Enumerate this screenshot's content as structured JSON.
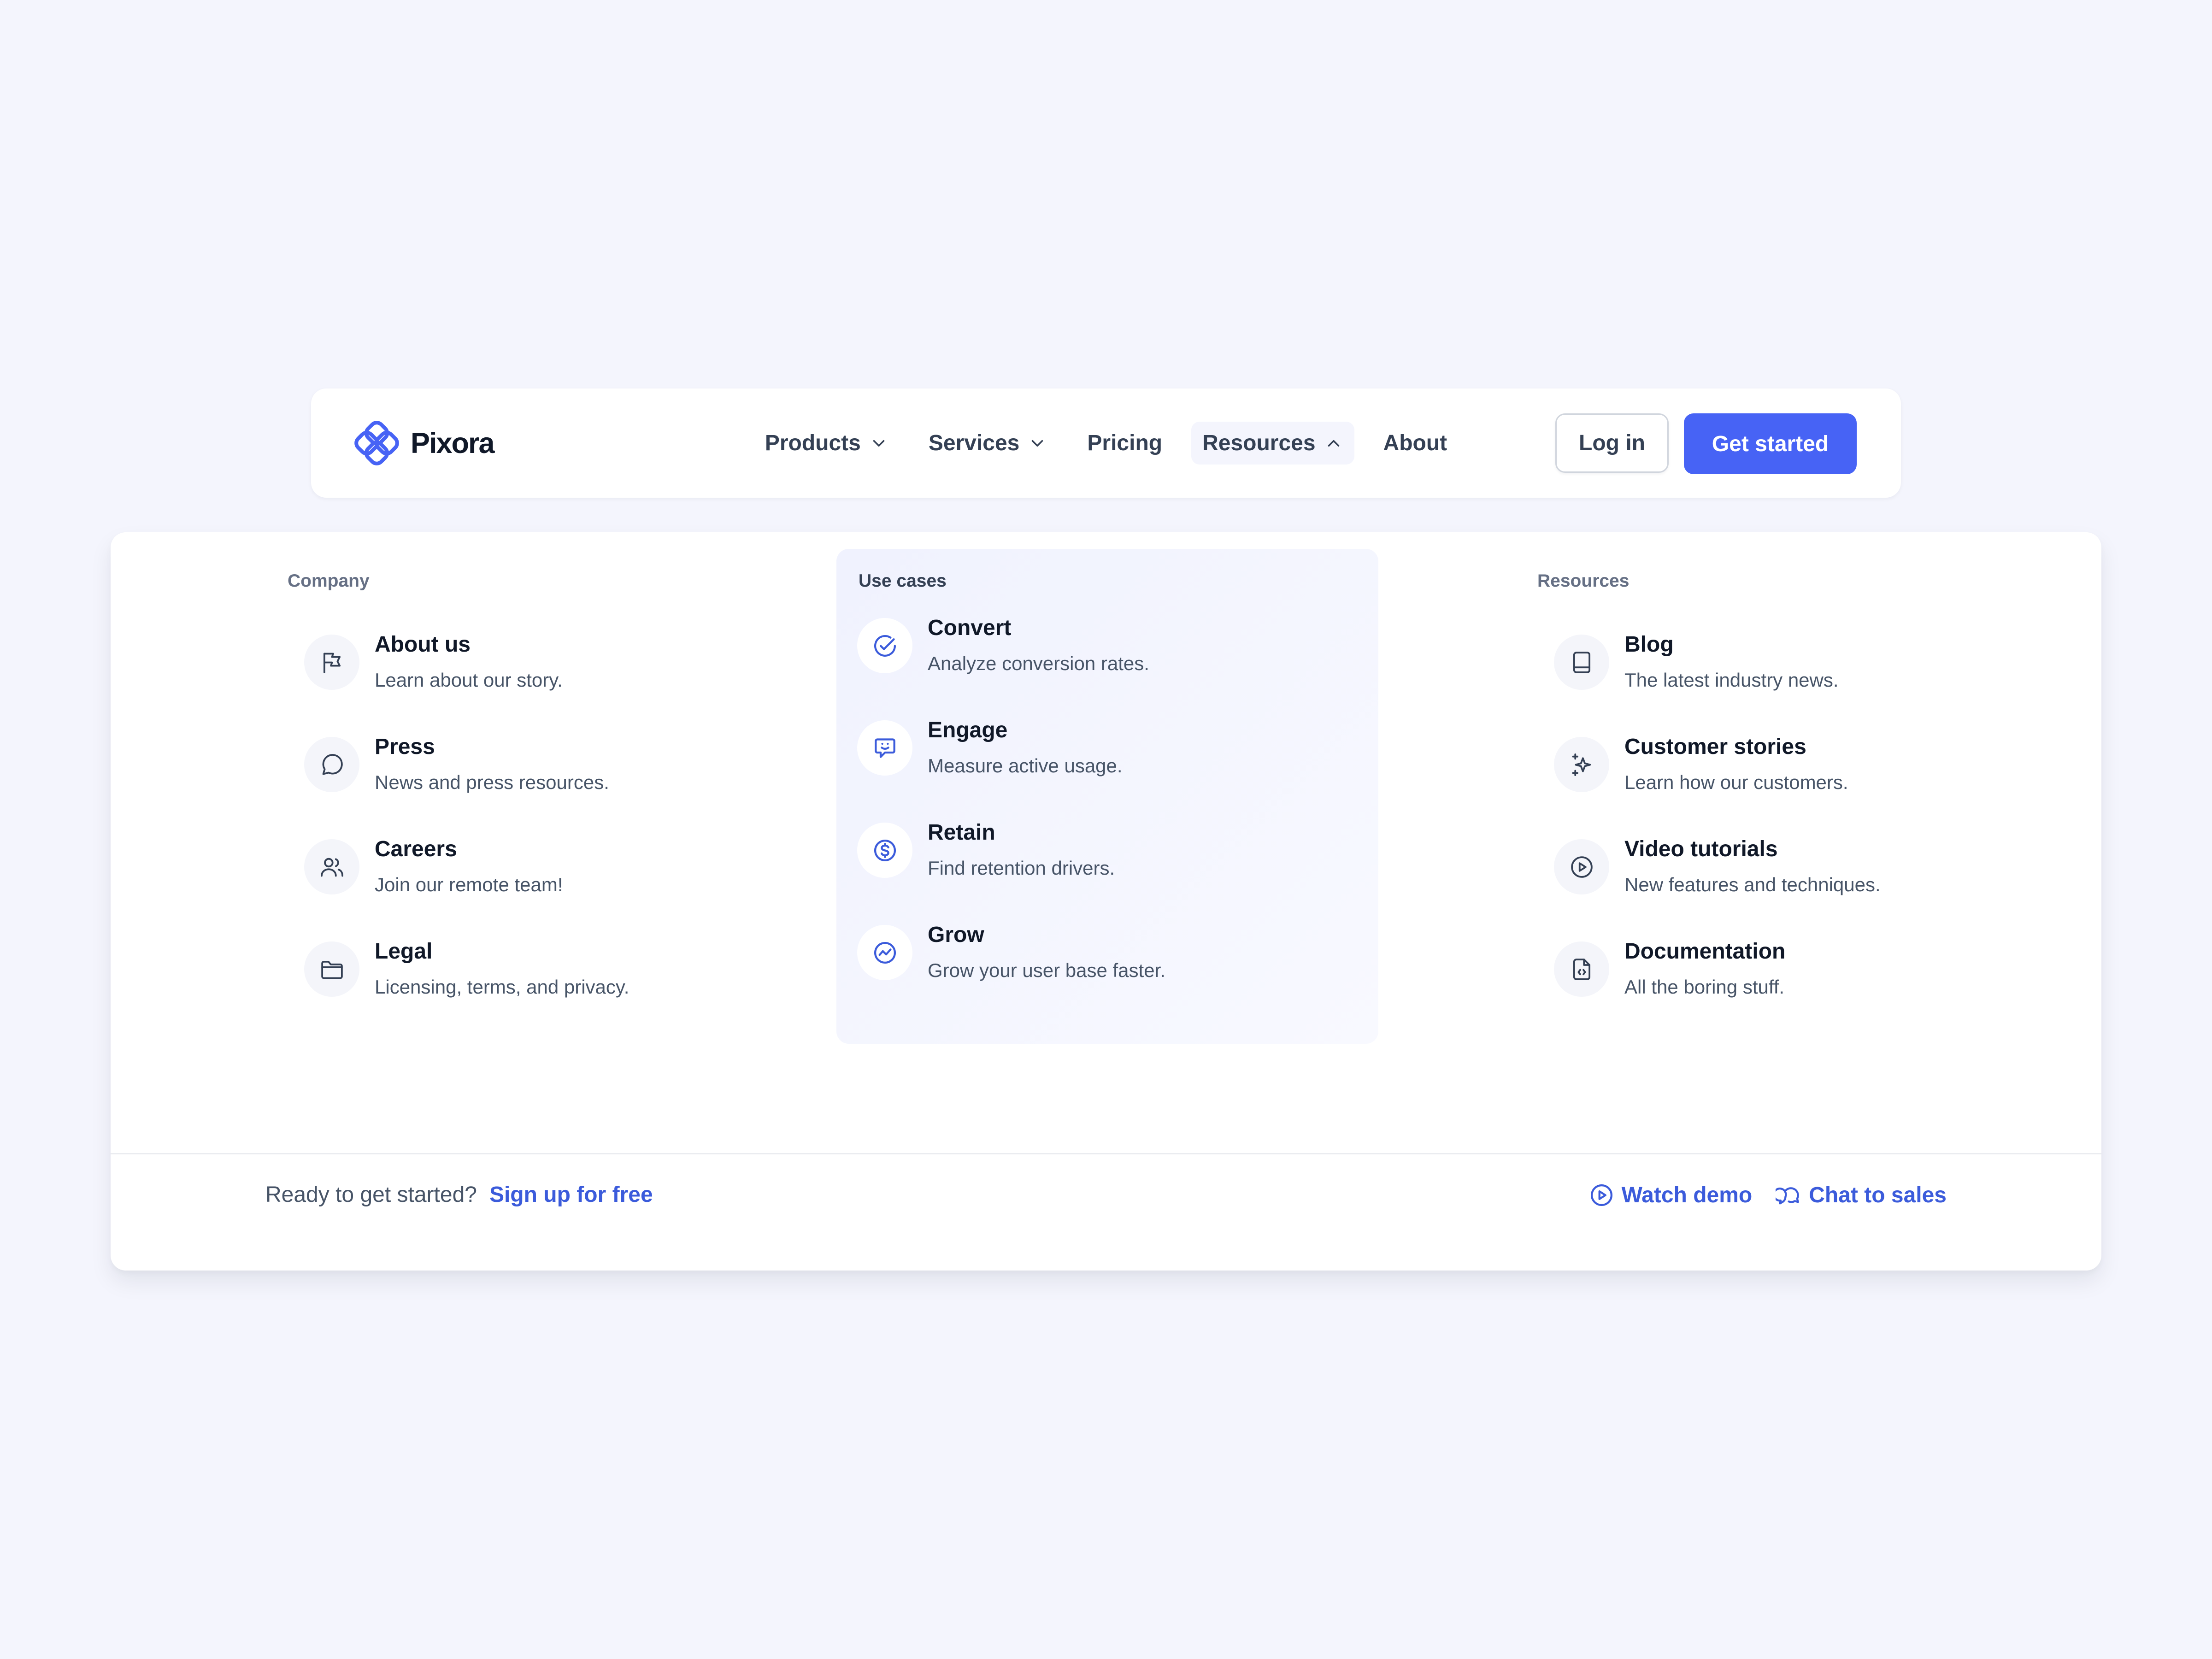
{
  "header": {
    "brand": "Pixora",
    "nav": [
      {
        "label": "Products",
        "has_dropdown": true
      },
      {
        "label": "Services",
        "has_dropdown": true
      },
      {
        "label": "Pricing",
        "has_dropdown": false
      },
      {
        "label": "Resources",
        "has_dropdown": true,
        "active": true
      },
      {
        "label": "About",
        "has_dropdown": false
      }
    ],
    "login_label": "Log in",
    "cta_label": "Get started"
  },
  "menu": {
    "company": {
      "title": "Company",
      "items": [
        {
          "title": "About us",
          "desc": "Learn about our story.",
          "icon": "flag-icon"
        },
        {
          "title": "Press",
          "desc": "News and press resources.",
          "icon": "chat-bubble-icon"
        },
        {
          "title": "Careers",
          "desc": "Join our remote team!",
          "icon": "users-icon"
        },
        {
          "title": "Legal",
          "desc": "Licensing, terms, and privacy.",
          "icon": "folder-icon"
        }
      ]
    },
    "use_cases": {
      "title": "Use cases",
      "items": [
        {
          "title": "Convert",
          "desc": "Analyze conversion rates.",
          "icon": "check-circle-icon"
        },
        {
          "title": "Engage",
          "desc": "Measure active usage.",
          "icon": "message-smile-icon"
        },
        {
          "title": "Retain",
          "desc": "Find retention drivers.",
          "icon": "dollar-circle-icon"
        },
        {
          "title": "Grow",
          "desc": "Grow your user base faster.",
          "icon": "trend-circle-icon"
        }
      ]
    },
    "resources": {
      "title": "Resources",
      "items": [
        {
          "title": "Blog",
          "desc": "The latest industry news.",
          "icon": "book-icon"
        },
        {
          "title": "Customer stories",
          "desc": "Learn how our customers.",
          "icon": "stars-icon"
        },
        {
          "title": "Video tutorials",
          "desc": "New features and techniques.",
          "icon": "play-circle-icon"
        },
        {
          "title": "Documentation",
          "desc": "All the boring stuff.",
          "icon": "file-code-icon"
        }
      ]
    }
  },
  "footer": {
    "question": "Ready to get started?",
    "signup_label": "Sign up for free",
    "watch_demo_label": "Watch demo",
    "chat_sales_label": "Chat to sales"
  },
  "colors": {
    "background": "#f4f5fd",
    "accent": "#4763f5",
    "link": "#3b5bdb",
    "text": "#101828",
    "muted": "#475467"
  }
}
